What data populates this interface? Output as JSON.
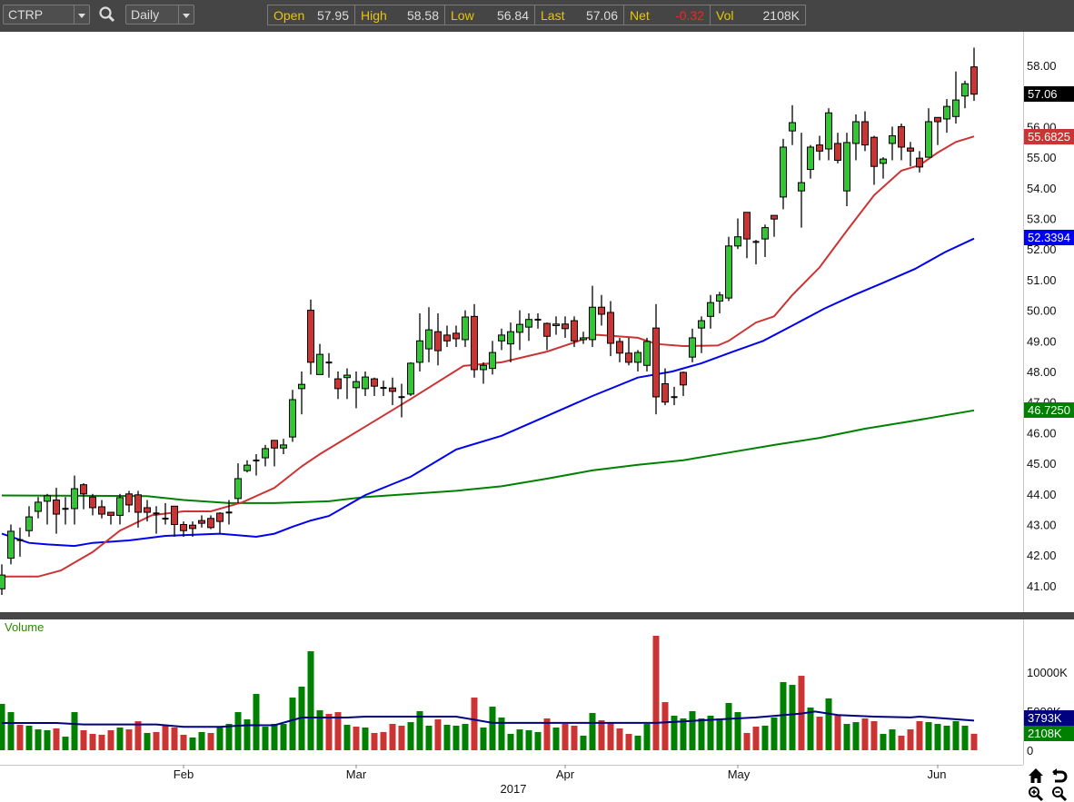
{
  "toolbar": {
    "symbol": "CTRP",
    "interval": "Daily",
    "quote": {
      "open_label": "Open",
      "open": "57.95",
      "high_label": "High",
      "high": "58.58",
      "low_label": "Low",
      "low": "56.84",
      "last_label": "Last",
      "last": "57.06",
      "net_label": "Net",
      "net": "-0.32",
      "vol_label": "Vol",
      "vol": "2108K"
    }
  },
  "colors": {
    "up": "#33c633",
    "down": "#cc3333",
    "ma20": "#cc3333",
    "ma50": "#0000ee",
    "ma200": "#008000",
    "volma": "#000080",
    "vol_up": "#008000",
    "vol_down": "#cc3333"
  },
  "price_axis": {
    "ticks": [
      "58.00",
      "57.00",
      "56.00",
      "55.00",
      "54.00",
      "53.00",
      "52.00",
      "51.00",
      "50.00",
      "49.00",
      "48.00",
      "47.00",
      "46.00",
      "45.00",
      "44.00",
      "43.00",
      "42.00",
      "41.00"
    ]
  },
  "badges": {
    "last": "57.06",
    "ma20": "55.6825",
    "ma50": "52.3394",
    "ma200": "46.7250",
    "volma": "3793K",
    "vol": "2108K"
  },
  "volume_panel": {
    "title": "Volume",
    "ticks": [
      "10000K",
      "5000K",
      "0"
    ]
  },
  "x_axis": {
    "months": [
      "Feb",
      "Mar",
      "Apr",
      "May",
      "Jun"
    ],
    "year": "2017"
  },
  "chart_data": {
    "type": "candlestick",
    "symbol": "CTRP",
    "ylim": [
      40.5,
      58.8
    ],
    "ohlc": [
      [
        40.9,
        41.7,
        40.7,
        41.35
      ],
      [
        41.9,
        43.0,
        41.7,
        42.78
      ],
      [
        42.5,
        42.9,
        41.95,
        42.5
      ],
      [
        42.8,
        43.6,
        42.6,
        43.25
      ],
      [
        43.43,
        43.9,
        43.2,
        43.73
      ],
      [
        43.76,
        44.0,
        43.0,
        43.94
      ],
      [
        43.8,
        44.2,
        42.7,
        43.34
      ],
      [
        43.52,
        43.9,
        43.0,
        43.52
      ],
      [
        43.52,
        44.6,
        43.0,
        44.17
      ],
      [
        44.3,
        44.35,
        43.5,
        44.0
      ],
      [
        43.9,
        44.0,
        43.3,
        43.55
      ],
      [
        43.58,
        43.8,
        43.2,
        43.34
      ],
      [
        43.4,
        43.4,
        43.0,
        43.3
      ],
      [
        43.3,
        44.0,
        43.0,
        43.88
      ],
      [
        44.0,
        44.1,
        43.4,
        43.64
      ],
      [
        43.97,
        44.1,
        42.9,
        43.4
      ],
      [
        43.55,
        43.8,
        43.1,
        43.4
      ],
      [
        43.37,
        43.6,
        42.7,
        43.37
      ],
      [
        43.2,
        43.7,
        43.0,
        43.2
      ],
      [
        43.6,
        43.6,
        42.6,
        43.0
      ],
      [
        43.0,
        43.1,
        42.6,
        42.8
      ],
      [
        42.98,
        43.1,
        42.6,
        42.87
      ],
      [
        43.13,
        43.3,
        42.9,
        43.04
      ],
      [
        43.2,
        43.3,
        42.85,
        42.9
      ],
      [
        43.37,
        43.4,
        42.7,
        43.1
      ],
      [
        43.4,
        43.8,
        43.0,
        43.4
      ],
      [
        43.85,
        45.0,
        43.7,
        44.5
      ],
      [
        44.76,
        45.1,
        44.7,
        44.94
      ],
      [
        45.1,
        45.3,
        44.6,
        45.1
      ],
      [
        45.18,
        45.6,
        44.9,
        45.48
      ],
      [
        45.75,
        45.75,
        44.9,
        45.5
      ],
      [
        45.5,
        45.8,
        45.3,
        45.6
      ],
      [
        45.86,
        47.4,
        45.7,
        47.08
      ],
      [
        47.44,
        48.0,
        46.6,
        47.58
      ],
      [
        50.0,
        50.35,
        47.9,
        48.3
      ],
      [
        47.9,
        48.9,
        47.9,
        48.56
      ],
      [
        48.3,
        48.6,
        47.8,
        48.3
      ],
      [
        47.76,
        48.0,
        47.1,
        47.44
      ],
      [
        47.8,
        48.1,
        47.1,
        47.88
      ],
      [
        47.47,
        48.0,
        46.8,
        47.67
      ],
      [
        47.44,
        48.0,
        47.2,
        47.82
      ],
      [
        47.76,
        47.8,
        47.2,
        47.52
      ],
      [
        47.47,
        47.7,
        47.2,
        47.47
      ],
      [
        47.46,
        47.8,
        46.9,
        47.35
      ],
      [
        47.17,
        47.6,
        46.5,
        47.17
      ],
      [
        47.26,
        48.3,
        47.2,
        48.27
      ],
      [
        48.3,
        49.9,
        48.0,
        49.0
      ],
      [
        48.74,
        50.1,
        48.3,
        49.36
      ],
      [
        49.3,
        49.9,
        48.2,
        48.68
      ],
      [
        49.19,
        49.5,
        48.8,
        49.0
      ],
      [
        49.25,
        49.5,
        48.8,
        49.07
      ],
      [
        49.04,
        50.0,
        48.8,
        49.78
      ],
      [
        49.8,
        50.2,
        47.8,
        48.06
      ],
      [
        48.06,
        48.3,
        47.6,
        48.2
      ],
      [
        48.1,
        49.0,
        47.9,
        48.62
      ],
      [
        49.0,
        49.4,
        48.7,
        49.19
      ],
      [
        48.9,
        49.6,
        48.3,
        49.3
      ],
      [
        49.28,
        50.0,
        48.7,
        49.54
      ],
      [
        49.45,
        49.9,
        49.0,
        49.7
      ],
      [
        49.7,
        49.9,
        49.4,
        49.7
      ],
      [
        49.57,
        49.6,
        48.7,
        49.15
      ],
      [
        49.5,
        49.8,
        49.2,
        49.55
      ],
      [
        49.55,
        49.8,
        49.1,
        49.4
      ],
      [
        49.66,
        49.8,
        48.8,
        49.0
      ],
      [
        49.04,
        49.3,
        48.9,
        49.1
      ],
      [
        49.04,
        50.8,
        48.8,
        50.1
      ],
      [
        50.1,
        50.5,
        49.5,
        49.87
      ],
      [
        49.93,
        50.3,
        48.5,
        48.92
      ],
      [
        48.98,
        49.1,
        48.3,
        48.6
      ],
      [
        48.6,
        49.1,
        48.2,
        48.3
      ],
      [
        48.3,
        48.7,
        48.0,
        48.62
      ],
      [
        48.2,
        49.1,
        48.0,
        48.98
      ],
      [
        49.42,
        50.2,
        46.6,
        47.17
      ],
      [
        47.6,
        48.1,
        46.9,
        47.0
      ],
      [
        47.17,
        47.5,
        46.9,
        47.17
      ],
      [
        47.97,
        48.0,
        47.2,
        47.56
      ],
      [
        48.47,
        49.4,
        48.3,
        49.1
      ],
      [
        49.42,
        49.8,
        48.6,
        49.66
      ],
      [
        49.8,
        50.5,
        49.4,
        50.25
      ],
      [
        50.3,
        50.6,
        49.9,
        50.5
      ],
      [
        50.4,
        52.4,
        50.3,
        52.1
      ],
      [
        52.1,
        53.0,
        52.0,
        52.4
      ],
      [
        53.2,
        53.2,
        51.7,
        52.33
      ],
      [
        52.24,
        52.3,
        51.5,
        52.24
      ],
      [
        52.33,
        52.8,
        51.74,
        52.7
      ],
      [
        53.1,
        53.1,
        52.4,
        52.98
      ],
      [
        53.7,
        55.6,
        53.3,
        55.33
      ],
      [
        55.86,
        56.7,
        55.4,
        56.13
      ],
      [
        53.9,
        55.8,
        52.7,
        54.17
      ],
      [
        54.6,
        55.4,
        54.3,
        55.33
      ],
      [
        55.4,
        55.7,
        54.9,
        55.2
      ],
      [
        55.27,
        56.6,
        54.9,
        56.45
      ],
      [
        55.45,
        55.8,
        54.8,
        54.9
      ],
      [
        53.9,
        55.8,
        53.4,
        55.48
      ],
      [
        55.45,
        56.4,
        54.9,
        56.16
      ],
      [
        56.16,
        56.5,
        55.2,
        55.4
      ],
      [
        55.65,
        55.7,
        54.1,
        54.7
      ],
      [
        54.8,
        55.0,
        54.3,
        54.94
      ],
      [
        55.45,
        56.0,
        54.9,
        55.7
      ],
      [
        56.0,
        56.1,
        54.9,
        55.33
      ],
      [
        55.3,
        55.5,
        54.7,
        55.2
      ],
      [
        54.97,
        55.2,
        54.5,
        54.68
      ],
      [
        55.0,
        56.6,
        55.0,
        56.16
      ],
      [
        56.3,
        56.3,
        55.4,
        56.16
      ],
      [
        56.25,
        56.9,
        55.8,
        56.66
      ],
      [
        56.33,
        57.8,
        56.1,
        56.87
      ],
      [
        57.0,
        57.5,
        56.6,
        57.4
      ],
      [
        57.95,
        58.58,
        56.84,
        57.06
      ]
    ],
    "volume_k": [
      5930,
      4880,
      3260,
      3140,
      2670,
      2560,
      2790,
      1740,
      4880,
      2560,
      2090,
      1980,
      2560,
      2910,
      2670,
      3720,
      2210,
      2330,
      3140,
      2910,
      1980,
      1630,
      2330,
      2210,
      2910,
      3370,
      4880,
      3950,
      7210,
      3020,
      3370,
      3370,
      6740,
      8140,
      12670,
      5120,
      4650,
      4880,
      3260,
      3020,
      2910,
      2210,
      2330,
      3370,
      3140,
      3600,
      5000,
      3140,
      3950,
      3260,
      3140,
      3370,
      6740,
      2910,
      5580,
      4190,
      2090,
      2670,
      2560,
      2330,
      4070,
      2910,
      3370,
      3140,
      1860,
      4770,
      3840,
      3490,
      2790,
      2090,
      1860,
      3370,
      14650,
      6160,
      4420,
      4070,
      5000,
      4070,
      4420,
      4070,
      6050,
      4880,
      2210,
      3020,
      3140,
      4190,
      8720,
      8370,
      9530,
      5470,
      4300,
      6630,
      4420,
      3370,
      3600,
      4070,
      3720,
      2090,
      2670,
      1860,
      2670,
      3720,
      3600,
      3370,
      3140,
      3720,
      3140,
      2108
    ],
    "ma20": [
      [
        0,
        41.3
      ],
      [
        4,
        41.3
      ],
      [
        6.5,
        41.5
      ],
      [
        10,
        42.1
      ],
      [
        13,
        42.8
      ],
      [
        16.5,
        43.3
      ],
      [
        20,
        43.43
      ],
      [
        23,
        43.43
      ],
      [
        26.5,
        43.73
      ],
      [
        30,
        44.2
      ],
      [
        33,
        44.9
      ],
      [
        35,
        45.3
      ],
      [
        40,
        46.2
      ],
      [
        45,
        47.1
      ],
      [
        50.8,
        48.18
      ],
      [
        55,
        48.3
      ],
      [
        60,
        48.65
      ],
      [
        65.5,
        49.2
      ],
      [
        70,
        49.1
      ],
      [
        72,
        48.9
      ],
      [
        75,
        48.83
      ],
      [
        78.8,
        48.85
      ],
      [
        80,
        49.0
      ],
      [
        83,
        49.6
      ],
      [
        85,
        49.8
      ],
      [
        87,
        50.5
      ],
      [
        90,
        51.4
      ],
      [
        93,
        52.6
      ],
      [
        96,
        53.76
      ],
      [
        99,
        54.56
      ],
      [
        101,
        54.74
      ],
      [
        103,
        55.15
      ],
      [
        105,
        55.5
      ],
      [
        107,
        55.68
      ]
    ],
    "ma50": [
      [
        0,
        42.7
      ],
      [
        3,
        42.4
      ],
      [
        5,
        42.35
      ],
      [
        8,
        42.3
      ],
      [
        10,
        42.4
      ],
      [
        14,
        42.48
      ],
      [
        18,
        42.63
      ],
      [
        24,
        42.7
      ],
      [
        28,
        42.6
      ],
      [
        30,
        42.7
      ],
      [
        32,
        42.93
      ],
      [
        34,
        43.13
      ],
      [
        36,
        43.28
      ],
      [
        40,
        43.96
      ],
      [
        45,
        44.56
      ],
      [
        50,
        45.45
      ],
      [
        55,
        45.9
      ],
      [
        60,
        46.55
      ],
      [
        65,
        47.2
      ],
      [
        70,
        47.8
      ],
      [
        73.8,
        48.0
      ],
      [
        77,
        48.27
      ],
      [
        80.5,
        48.65
      ],
      [
        83.8,
        49.0
      ],
      [
        87,
        49.5
      ],
      [
        90.5,
        50.05
      ],
      [
        93.8,
        50.5
      ],
      [
        97,
        50.9
      ],
      [
        100.5,
        51.35
      ],
      [
        103.8,
        51.9
      ],
      [
        107,
        52.34
      ]
    ],
    "ma200": [
      [
        0,
        43.95
      ],
      [
        16,
        43.93
      ],
      [
        20,
        43.8
      ],
      [
        25,
        43.7
      ],
      [
        30,
        43.7
      ],
      [
        36,
        43.76
      ],
      [
        40,
        43.9
      ],
      [
        50,
        44.1
      ],
      [
        55,
        44.25
      ],
      [
        60,
        44.5
      ],
      [
        65,
        44.77
      ],
      [
        70,
        44.95
      ],
      [
        75,
        45.1
      ],
      [
        80,
        45.35
      ],
      [
        85,
        45.6
      ],
      [
        90,
        45.83
      ],
      [
        95,
        46.13
      ],
      [
        100,
        46.37
      ],
      [
        107,
        46.73
      ]
    ],
    "volume_ma_k": [
      [
        0,
        3490
      ],
      [
        6,
        3490
      ],
      [
        9,
        3300
      ],
      [
        17,
        3300
      ],
      [
        20,
        3000
      ],
      [
        24,
        3000
      ],
      [
        27,
        3200
      ],
      [
        30,
        3200
      ],
      [
        33,
        4190
      ],
      [
        38,
        4190
      ],
      [
        40,
        4300
      ],
      [
        50,
        4300
      ],
      [
        54,
        3500
      ],
      [
        72,
        3500
      ],
      [
        75,
        3700
      ],
      [
        83,
        4200
      ],
      [
        88,
        4700
      ],
      [
        89.5,
        4950
      ],
      [
        92,
        4500
      ],
      [
        96,
        4300
      ],
      [
        100,
        4200
      ],
      [
        101,
        4300
      ],
      [
        107,
        3793
      ]
    ],
    "month_start_index": {
      "Feb": 20,
      "Mar": 39,
      "Apr": 62,
      "May": 81,
      "Jun": 103
    }
  }
}
